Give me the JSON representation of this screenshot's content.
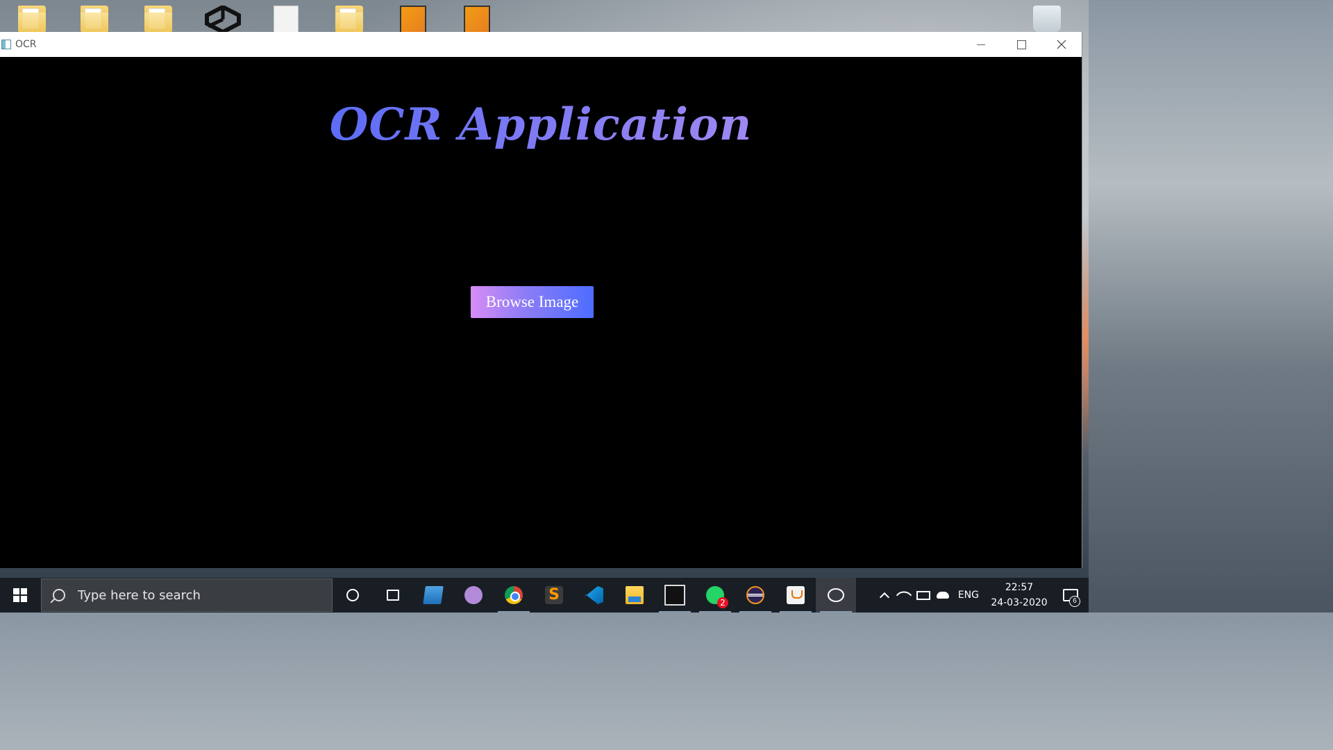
{
  "desktop": {
    "icons": [
      "folder-icon",
      "folder-icon",
      "folder-icon",
      "unity-icon",
      "document-icon",
      "folder-icon",
      "sweet-home-3d-icon",
      "sweet-home-3d-icon",
      "recycle-bin-icon"
    ]
  },
  "window": {
    "title": "OCR",
    "controls": [
      "minimize-icon",
      "maximize-icon",
      "close-icon"
    ]
  },
  "app": {
    "heading": "OCR Application",
    "browse_button": "Browse Image",
    "colors": {
      "background": "#000000",
      "gradient_start": "#3b5bff",
      "gradient_end": "#e3aaf0"
    }
  },
  "taskbar": {
    "search_placeholder": "Type here to search",
    "apps": [
      "cortana-icon",
      "task-view-icon",
      "this-pc-icon",
      "github-desktop-icon",
      "chrome-icon",
      "sublime-text-icon",
      "vscode-icon",
      "file-explorer-icon",
      "command-prompt-icon",
      "whatsapp-icon",
      "eclipse-icon",
      "java-icon",
      "photos-icon"
    ],
    "whatsapp_badge": "2",
    "tray": {
      "language": "ENG",
      "time": "22:57",
      "date": "24-03-2020",
      "notification_count": "6"
    }
  }
}
